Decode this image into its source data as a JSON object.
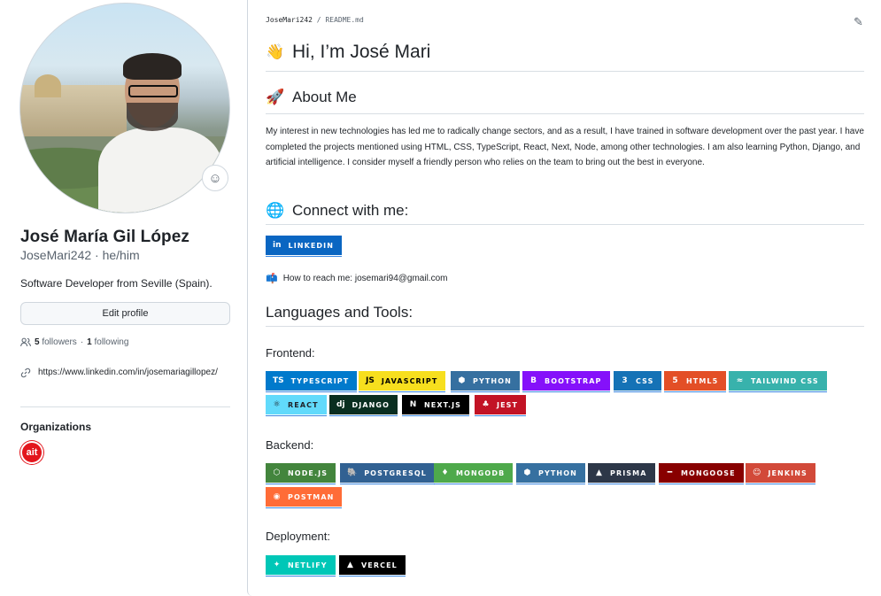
{
  "profile": {
    "full_name": "José María Gil López",
    "login_line": "JoseMari242 · he/him",
    "bio": "Software Developer from Seville (Spain).",
    "edit_label": "Edit profile",
    "followers_count": "5",
    "followers_label": "followers",
    "separator": "·",
    "following_count": "1",
    "following_label": "following",
    "website": "https://www.linkedin.com/in/josemariagillopez/",
    "organizations_title": "Organizations",
    "org_badge_text": "ait",
    "status_icon": "smiley-icon"
  },
  "readme": {
    "path_user": "JoseMari242",
    "path_sep": " / ",
    "path_file": "README.md",
    "title": "Hi, I’m José Mari",
    "title_emoji": "👋",
    "about_title": "About Me",
    "about_emoji": "🚀",
    "about_text": "My interest in new technologies has led me to radically change sectors, and as a result, I have trained in software development over the past year. I have completed the projects mentioned using HTML, CSS, TypeScript, React, Next, Node, among other technologies. I am also learning Python, Django, and artificial intelligence. I consider myself a friendly person who relies on the team to bring out the best in everyone.",
    "connect_title": "Connect with me:",
    "connect_emoji": "🌐",
    "reach_emoji": "📫",
    "reach_text": "How to reach me: josemari94@gmail.com",
    "languages_title": "Languages and Tools:",
    "frontend_title": "Frontend:",
    "backend_title": "Backend:",
    "deployment_title": "Deployment:"
  },
  "badges": {
    "linkedin": {
      "label": "LINKEDIN",
      "icon": "in",
      "color": "#0A66C2",
      "fg": "#ffffff"
    },
    "typescript": {
      "label": "TYPESCRIPT",
      "icon": "TS",
      "color": "#007ACC",
      "fg": "#ffffff"
    },
    "javascript": {
      "label": "JAVASCRIPT",
      "icon": "JS",
      "color": "#F7DF1E",
      "fg": "#000000"
    },
    "python_fe": {
      "label": "PYTHON",
      "icon": "⬢",
      "color": "#3670A0",
      "fg": "#ffffff"
    },
    "bootstrap": {
      "label": "BOOTSTRAP",
      "icon": "B",
      "color": "#8511FA",
      "fg": "#ffffff"
    },
    "css": {
      "label": "CSS",
      "icon": "3",
      "color": "#1572B6",
      "fg": "#ffffff"
    },
    "html": {
      "label": "HTML5",
      "icon": "5",
      "color": "#E34F26",
      "fg": "#ffffff"
    },
    "tailwind": {
      "label": "TAILWIND CSS",
      "icon": "≈",
      "color": "#38B2AC",
      "fg": "#ffffff"
    },
    "react": {
      "label": "REACT",
      "icon": "⚛",
      "color": "#61DAFB",
      "fg": "#20232a"
    },
    "django": {
      "label": "DJANGO",
      "icon": "dj",
      "color": "#092E20",
      "fg": "#ffffff"
    },
    "nextjs": {
      "label": "NEXT.JS",
      "icon": "N",
      "color": "#000000",
      "fg": "#ffffff"
    },
    "jest": {
      "label": "JEST",
      "icon": "♣",
      "color": "#C21325",
      "fg": "#ffffff"
    },
    "nodejs": {
      "label": "NODE.JS",
      "icon": "⬡",
      "color": "#43853D",
      "fg": "#ffffff"
    },
    "postgresql": {
      "label": "POSTGRESQL",
      "icon": "🐘",
      "color": "#316192",
      "fg": "#ffffff"
    },
    "mongodb": {
      "label": "MONGODB",
      "icon": "♦",
      "color": "#4EA94B",
      "fg": "#ffffff"
    },
    "python_be": {
      "label": "PYTHON",
      "icon": "⬢",
      "color": "#3670A0",
      "fg": "#ffffff"
    },
    "prisma": {
      "label": "PRISMA",
      "icon": "▲",
      "color": "#2D3748",
      "fg": "#ffffff"
    },
    "mongoose": {
      "label": "MONGOOSE",
      "icon": "━",
      "color": "#880000",
      "fg": "#ffffff"
    },
    "jenkins": {
      "label": "JENKINS",
      "icon": "☺",
      "color": "#D24939",
      "fg": "#ffffff"
    },
    "postman": {
      "label": "POSTMAN",
      "icon": "◉",
      "color": "#FF6C37",
      "fg": "#ffffff"
    },
    "netlify": {
      "label": "NETLIFY",
      "icon": "✦",
      "color": "#00C7B7",
      "fg": "#ffffff"
    },
    "vercel": {
      "label": "VERCEL",
      "icon": "▲",
      "color": "#000000",
      "fg": "#ffffff"
    }
  }
}
